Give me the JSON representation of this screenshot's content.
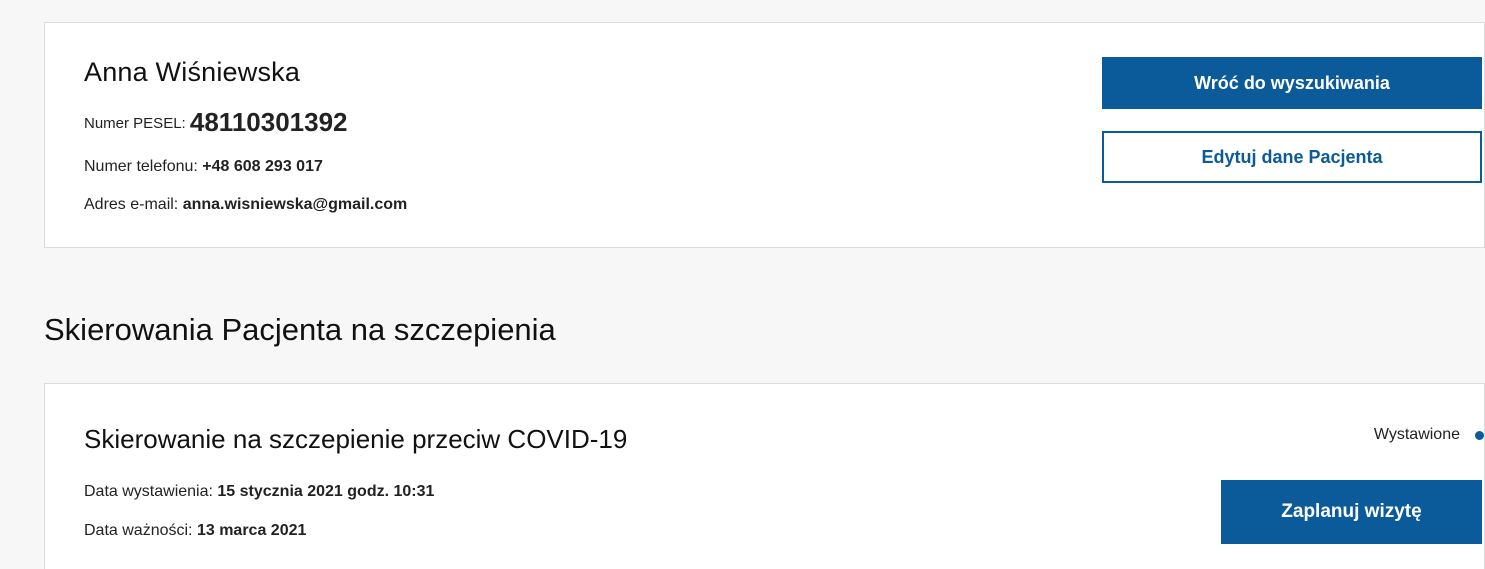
{
  "patient": {
    "name": "Anna Wiśniewska",
    "pesel_label": "Numer PESEL:",
    "pesel_value": "48110301392",
    "phone_label": "Numer telefonu:",
    "phone_value": "+48 608 293 017",
    "email_label": "Adres e-mail:",
    "email_value": "anna.wisniewska@gmail.com"
  },
  "actions": {
    "back_label": "Wróć do wyszukiwania",
    "edit_label": "Edytuj dane Pacjenta"
  },
  "referrals": {
    "section_title": "Skierowania Pacjenta na szczepienia",
    "items": [
      {
        "title": "Skierowanie na szczepienie przeciw COVID-19",
        "issued_label": "Data wystawienia:",
        "issued_value": "15 stycznia 2021 godz. 10:31",
        "valid_label": "Data ważności:",
        "valid_value": "13 marca 2021",
        "status": "Wystawione",
        "status_color": "#0b5b9a",
        "schedule_label": "Zaplanuj wizytę"
      }
    ]
  },
  "colors": {
    "primary": "#0b5b9a",
    "background": "#f7f7f7",
    "card": "#ffffff",
    "border": "#dcdcdc"
  }
}
